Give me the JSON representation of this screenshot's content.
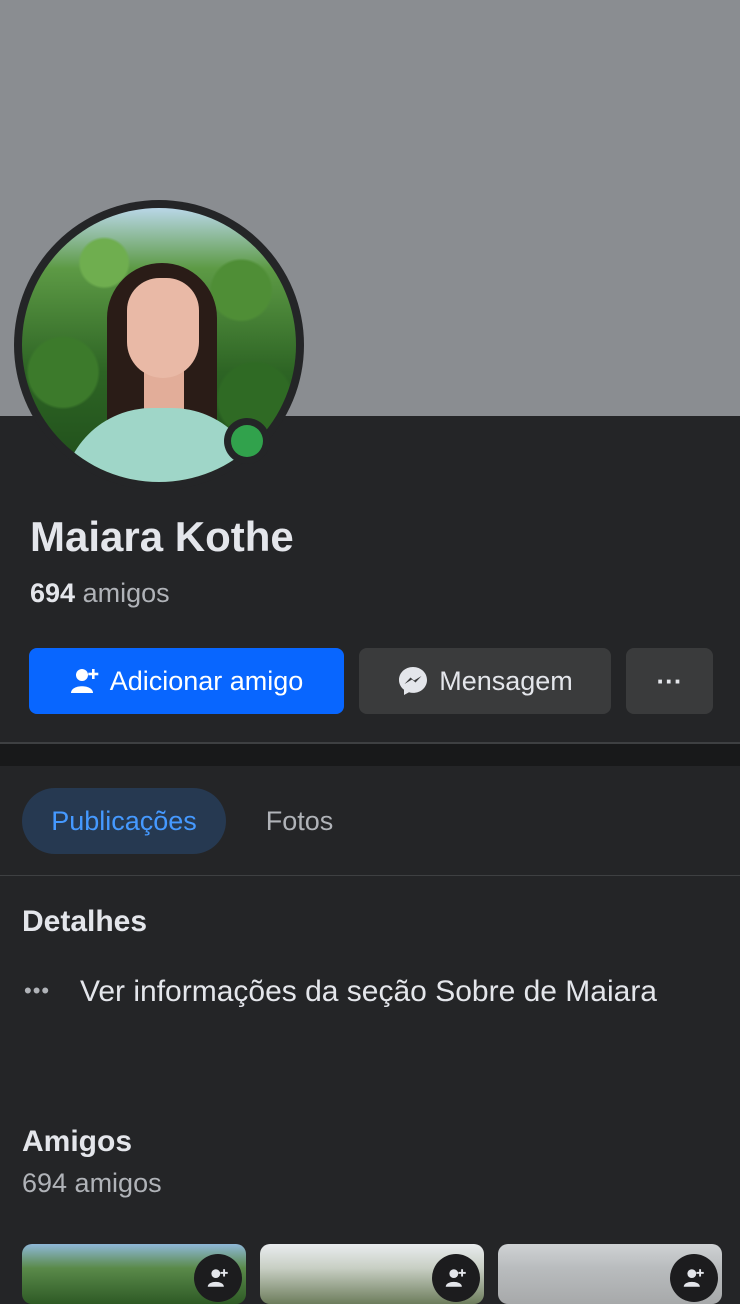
{
  "profile": {
    "name": "Maiara Kothe",
    "friends_count": "694",
    "friends_word": "amigos",
    "online_color": "#31a24c"
  },
  "actions": {
    "add_friend_label": "Adicionar amigo",
    "message_label": "Mensagem",
    "more_label": "···",
    "add_friend_icon": "add-user-icon",
    "message_icon": "messenger-icon",
    "accent_color": "#0866ff"
  },
  "tabs": [
    {
      "label": "Publicações",
      "active": true
    },
    {
      "label": "Fotos",
      "active": false
    }
  ],
  "details": {
    "heading": "Detalhes",
    "item_icon": "more-dots-icon",
    "item_text": "Ver informações da seção Sobre de Maiara"
  },
  "friends_section": {
    "heading": "Amigos",
    "count_text": "694 amigos"
  }
}
